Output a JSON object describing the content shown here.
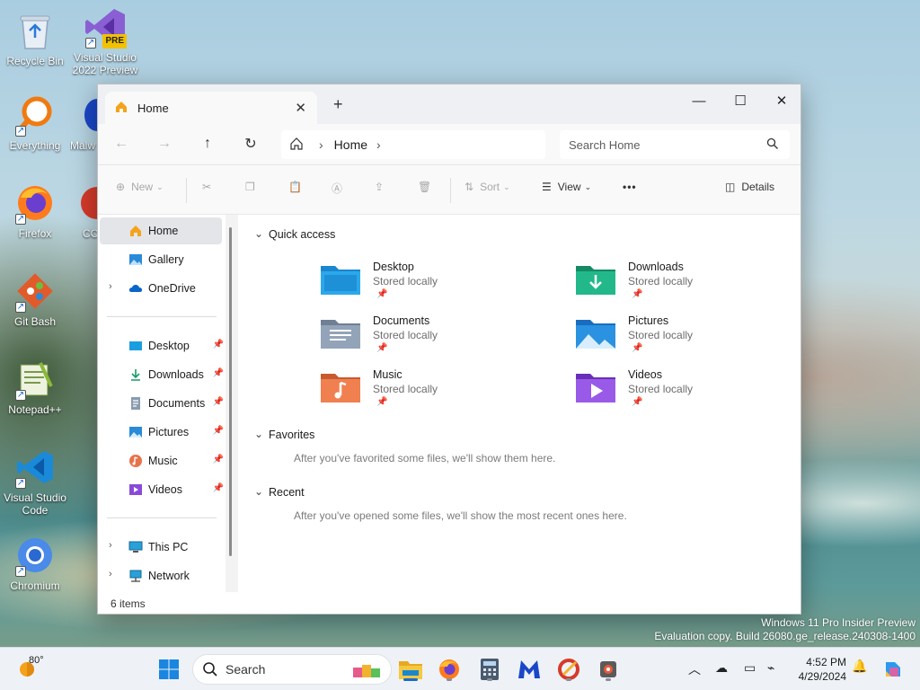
{
  "desktop": {
    "icons": [
      {
        "label": "Recycle Bin"
      },
      {
        "label": "Visual Studio 2022 Preview",
        "badge": "PRE"
      },
      {
        "label": "Everything"
      },
      {
        "label": "Malw"
      },
      {
        "label": "Firefox"
      },
      {
        "label": "CC"
      },
      {
        "label": "Git Bash"
      },
      {
        "label": "Notepad++"
      },
      {
        "label": "Visual Studio Code"
      },
      {
        "label": "Chromium"
      }
    ],
    "watermark": {
      "line1": "Windows 11 Pro Insider Preview",
      "line2": "Evaluation copy. Build 26080.ge_release.240308-1400"
    }
  },
  "explorer": {
    "tab": {
      "title": "Home",
      "close": "✕",
      "new_tab": "+"
    },
    "window_controls": {
      "minimize": "—",
      "maximize": "☐",
      "close": "✕"
    },
    "address": {
      "breadcrumb": "Home"
    },
    "search": {
      "placeholder": "Search Home"
    },
    "commands": {
      "new": "New",
      "sort": "Sort",
      "view": "View",
      "more": "•••",
      "details": "Details"
    },
    "sidebar": {
      "items": [
        {
          "label": "Home",
          "icon": "home-icon"
        },
        {
          "label": "Gallery",
          "icon": "gallery-icon"
        },
        {
          "label": "OneDrive",
          "icon": "cloud-icon"
        },
        {
          "label": "Desktop",
          "icon": "desktop-icon"
        },
        {
          "label": "Downloads",
          "icon": "download-icon"
        },
        {
          "label": "Documents",
          "icon": "documents-icon"
        },
        {
          "label": "Pictures",
          "icon": "pictures-icon"
        },
        {
          "label": "Music",
          "icon": "music-icon"
        },
        {
          "label": "Videos",
          "icon": "videos-icon"
        },
        {
          "label": "This PC",
          "icon": "pc-icon"
        },
        {
          "label": "Network",
          "icon": "network-icon"
        }
      ]
    },
    "status": "6 items",
    "quick_access": {
      "title": "Quick access",
      "items": [
        {
          "name": "Desktop",
          "sub": "Stored locally",
          "color": "#1a9ee0"
        },
        {
          "name": "Downloads",
          "sub": "Stored locally",
          "color": "#1fb58a"
        },
        {
          "name": "Documents",
          "sub": "Stored locally",
          "color": "#8a9bb0"
        },
        {
          "name": "Pictures",
          "sub": "Stored locally",
          "color": "#2a8ad8"
        },
        {
          "name": "Music",
          "sub": "Stored locally",
          "color": "#e8734a"
        },
        {
          "name": "Videos",
          "sub": "Stored locally",
          "color": "#8a4ad8"
        }
      ]
    },
    "favorites": {
      "title": "Favorites",
      "note": "After you've favorited some files, we'll show them here."
    },
    "recent": {
      "title": "Recent",
      "note": "After you've opened some files, we'll show the most recent ones here."
    }
  },
  "taskbar": {
    "weather": "80°",
    "search_label": "Search",
    "clock": {
      "time": "4:52 PM",
      "date": "4/29/2024"
    }
  }
}
